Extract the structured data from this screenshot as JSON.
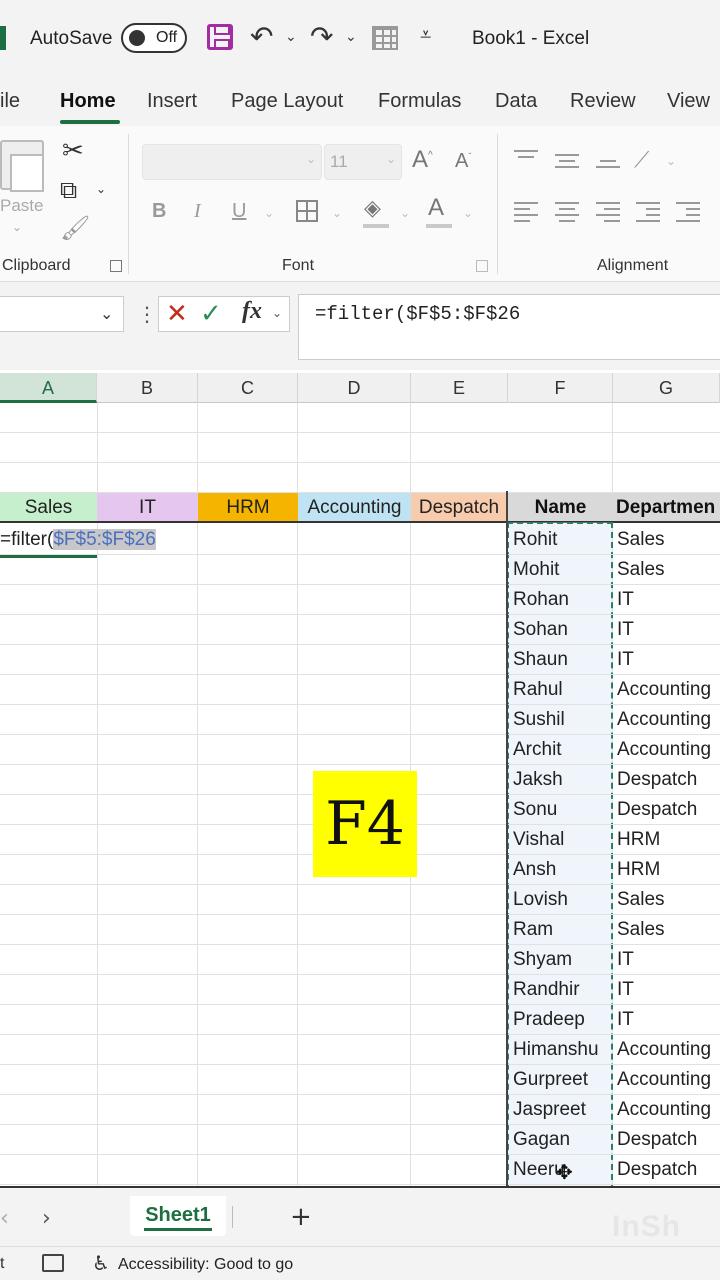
{
  "titlebar": {
    "autosave_label": "AutoSave",
    "autosave_state": "Off",
    "doc_title": "Book1  -  Excel"
  },
  "ribbon_tabs": [
    {
      "label": "ile",
      "active": false
    },
    {
      "label": "Home",
      "active": true
    },
    {
      "label": "Insert",
      "active": false
    },
    {
      "label": "Page Layout",
      "active": false
    },
    {
      "label": "Formulas",
      "active": false
    },
    {
      "label": "Data",
      "active": false
    },
    {
      "label": "Review",
      "active": false
    },
    {
      "label": "View",
      "active": false
    }
  ],
  "ribbon": {
    "clipboard": {
      "paste_label": "Paste",
      "group_label": "Clipboard"
    },
    "font": {
      "font_size": "11",
      "bold": "B",
      "italic": "I",
      "underline": "U",
      "group_label": "Font"
    },
    "alignment": {
      "group_label": "Alignment"
    }
  },
  "formula_bar": {
    "name_box": "",
    "cancel_glyph": "✕",
    "enter_glyph": "✓",
    "fx_label": "fx",
    "formula": "=filter($F$5:$F$26"
  },
  "grid": {
    "columns": [
      "A",
      "B",
      "C",
      "D",
      "E",
      "F",
      "G"
    ],
    "active_column": "A",
    "category_headers": [
      {
        "label": "Sales",
        "color": "#c6efce"
      },
      {
        "label": "IT",
        "color": "#e4c6ef"
      },
      {
        "label": "HRM",
        "color": "#f4b400"
      },
      {
        "label": "Accounting",
        "color": "#bfe3f2"
      },
      {
        "label": "Despatch",
        "color": "#f8cbad"
      }
    ],
    "table_headers": {
      "name": "Name",
      "department": "Departmen"
    },
    "formula_cell": {
      "prefix": "=filter(",
      "reference": "$F$5:$F$26"
    },
    "rows": [
      {
        "name": "Rohit",
        "department": "Sales"
      },
      {
        "name": "Mohit",
        "department": "Sales"
      },
      {
        "name": "Rohan",
        "department": "IT"
      },
      {
        "name": "Sohan",
        "department": "IT"
      },
      {
        "name": "Shaun",
        "department": "IT"
      },
      {
        "name": "Rahul",
        "department": "Accounting"
      },
      {
        "name": "Sushil",
        "department": "Accounting"
      },
      {
        "name": "Archit",
        "department": "Accounting"
      },
      {
        "name": "Jaksh",
        "department": "Despatch"
      },
      {
        "name": "Sonu",
        "department": "Despatch"
      },
      {
        "name": "Vishal",
        "department": "HRM"
      },
      {
        "name": "Ansh",
        "department": "HRM"
      },
      {
        "name": "Lovish",
        "department": "Sales"
      },
      {
        "name": "Ram",
        "department": "Sales"
      },
      {
        "name": "Shyam",
        "department": "IT"
      },
      {
        "name": "Randhir",
        "department": "IT"
      },
      {
        "name": "Pradeep",
        "department": "IT"
      },
      {
        "name": "Himanshu",
        "department": "Accounting"
      },
      {
        "name": "Gurpreet",
        "department": "Accounting"
      },
      {
        "name": "Jaspreet",
        "department": "Accounting"
      },
      {
        "name": "Gagan",
        "department": "Despatch"
      },
      {
        "name": "Neeru",
        "department": "Despatch"
      }
    ]
  },
  "overlay": {
    "key_label": "F4",
    "key_color": "#ffff00"
  },
  "sheet_bar": {
    "sheet_name": "Sheet1",
    "add_sheet": "+",
    "watermark": "InSh"
  },
  "status_bar": {
    "left_fragment": "t",
    "accessibility": "Accessibility: Good to go"
  },
  "colors": {
    "excel_green": "#1d6f42",
    "save_purple": "#a32ca3",
    "cancel_red": "#c42b1c"
  }
}
